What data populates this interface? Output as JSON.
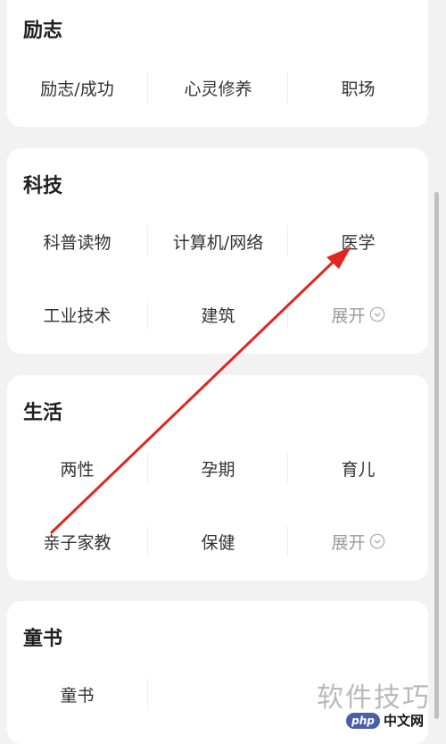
{
  "sections": [
    {
      "title": "励志",
      "items": [
        "励志/成功",
        "心灵修养",
        "职场"
      ],
      "expand": ""
    },
    {
      "title": "科技",
      "items": [
        "科普读物",
        "计算机/网络",
        "医学",
        "工业技术",
        "建筑"
      ],
      "expand": "展开"
    },
    {
      "title": "生活",
      "items": [
        "两性",
        "孕期",
        "育儿",
        "亲子家教",
        "保健"
      ],
      "expand": "展开"
    },
    {
      "title": "童书",
      "items": [
        "童书"
      ],
      "expand": ""
    }
  ],
  "watermark": {
    "text": "软件技巧",
    "badge_logo": "php",
    "badge_text": "中文网"
  },
  "annotation": {
    "arrow_color": "#e0271f",
    "icon": "arrow-annotation"
  },
  "colors": {
    "background": "#f2f2f2",
    "card": "#ffffff",
    "expand_text": "#9a9a9a"
  }
}
